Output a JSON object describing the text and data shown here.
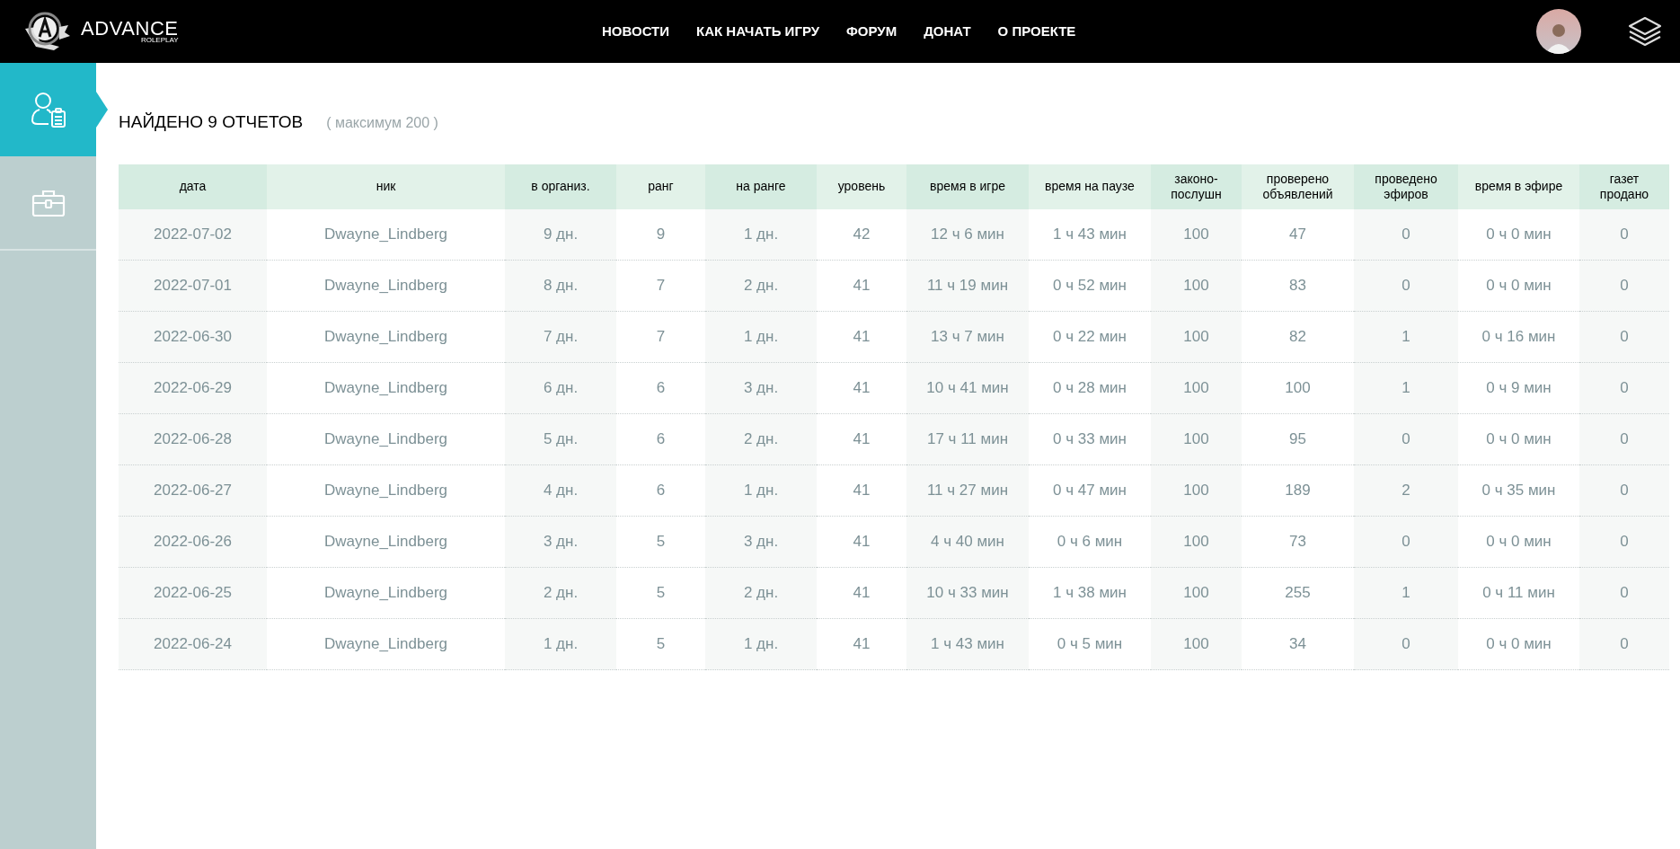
{
  "logo": {
    "title": "ADVANCE",
    "subtitle": "ROLEPLAY"
  },
  "nav": [
    "НОВОСТИ",
    "КАК НАЧАТЬ ИГРУ",
    "ФОРУМ",
    "ДОНАТ",
    "О ПРОЕКТЕ"
  ],
  "sidebar": {
    "items": [
      {
        "kind": "reports",
        "selected": true
      },
      {
        "kind": "briefcase",
        "selected": false
      }
    ]
  },
  "heading": {
    "title": "НАЙДЕНО 9 ОТЧЕТОВ",
    "note": "( максимум 200 )"
  },
  "table": {
    "columns": [
      "дата",
      "ник",
      "в организ.",
      "ранг",
      "на ранге",
      "уровень",
      "время в игре",
      "время на паузе",
      "законо-послушн",
      "проверено объявлений",
      "проведено эфиров",
      "время в эфире",
      "газет продано"
    ],
    "rows": [
      [
        "2022-07-02",
        "Dwayne_Lindberg",
        "9 дн.",
        "9",
        "1 дн.",
        "42",
        "12 ч 6 мин",
        "1 ч 43 мин",
        "100",
        "47",
        "0",
        "0 ч 0 мин",
        "0"
      ],
      [
        "2022-07-01",
        "Dwayne_Lindberg",
        "8 дн.",
        "7",
        "2 дн.",
        "41",
        "11 ч 19 мин",
        "0 ч 52 мин",
        "100",
        "83",
        "0",
        "0 ч 0 мин",
        "0"
      ],
      [
        "2022-06-30",
        "Dwayne_Lindberg",
        "7 дн.",
        "7",
        "1 дн.",
        "41",
        "13 ч 7 мин",
        "0 ч 22 мин",
        "100",
        "82",
        "1",
        "0 ч 16 мин",
        "0"
      ],
      [
        "2022-06-29",
        "Dwayne_Lindberg",
        "6 дн.",
        "6",
        "3 дн.",
        "41",
        "10 ч 41 мин",
        "0 ч 28 мин",
        "100",
        "100",
        "1",
        "0 ч 9 мин",
        "0"
      ],
      [
        "2022-06-28",
        "Dwayne_Lindberg",
        "5 дн.",
        "6",
        "2 дн.",
        "41",
        "17 ч 11 мин",
        "0 ч 33 мин",
        "100",
        "95",
        "0",
        "0 ч 0 мин",
        "0"
      ],
      [
        "2022-06-27",
        "Dwayne_Lindberg",
        "4 дн.",
        "6",
        "1 дн.",
        "41",
        "11 ч 27 мин",
        "0 ч 47 мин",
        "100",
        "189",
        "2",
        "0 ч 35 мин",
        "0"
      ],
      [
        "2022-06-26",
        "Dwayne_Lindberg",
        "3 дн.",
        "5",
        "3 дн.",
        "41",
        "4 ч 40 мин",
        "0 ч 6 мин",
        "100",
        "73",
        "0",
        "0 ч 0 мин",
        "0"
      ],
      [
        "2022-06-25",
        "Dwayne_Lindberg",
        "2 дн.",
        "5",
        "2 дн.",
        "41",
        "10 ч 33 мин",
        "1 ч 38 мин",
        "100",
        "255",
        "1",
        "0 ч 11 мин",
        "0"
      ],
      [
        "2022-06-24",
        "Dwayne_Lindberg",
        "1 дн.",
        "5",
        "1 дн.",
        "41",
        "1 ч 43 мин",
        "0 ч 5 мин",
        "100",
        "34",
        "0",
        "0 ч 0 мин",
        "0"
      ]
    ]
  }
}
